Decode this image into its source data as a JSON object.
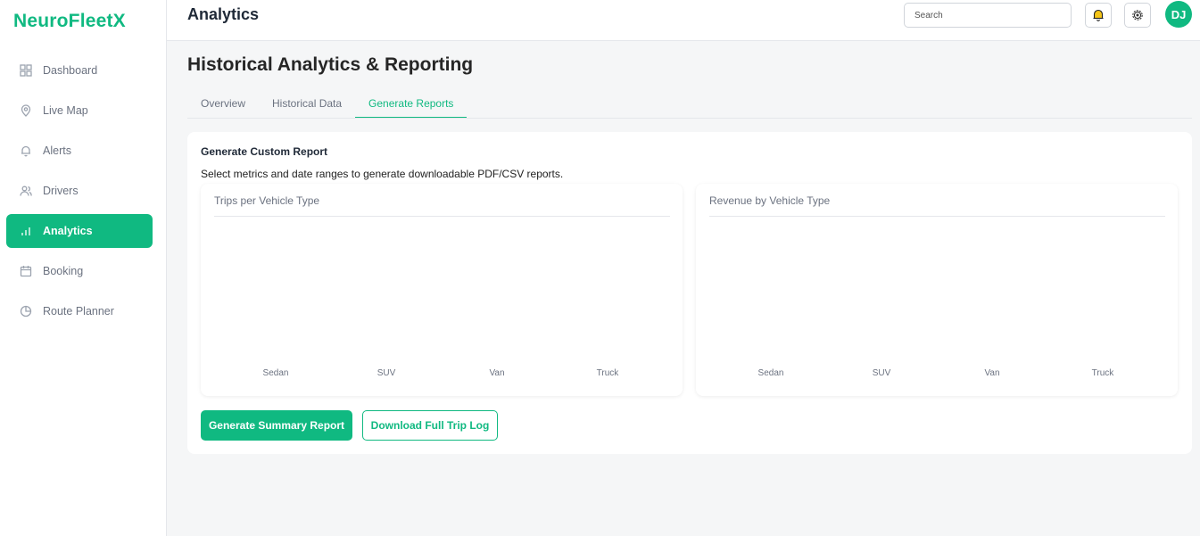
{
  "app": {
    "name": "NeuroFleetX"
  },
  "sidebar": {
    "items": [
      {
        "label": "Dashboard",
        "icon": "grid-icon"
      },
      {
        "label": "Live Map",
        "icon": "map-pin-icon"
      },
      {
        "label": "Alerts",
        "icon": "bell-icon"
      },
      {
        "label": "Drivers",
        "icon": "users-icon"
      },
      {
        "label": "Analytics",
        "icon": "bar-chart-icon",
        "active": true
      },
      {
        "label": "Booking",
        "icon": "calendar-icon"
      },
      {
        "label": "Route Planner",
        "icon": "pie-icon"
      }
    ]
  },
  "header": {
    "title": "Analytics",
    "search_placeholder": "Search",
    "avatar_initials": "DJ"
  },
  "page": {
    "title": "Historical Analytics & Reporting",
    "tabs": [
      {
        "label": "Overview"
      },
      {
        "label": "Historical Data"
      },
      {
        "label": "Generate Reports",
        "active": true
      }
    ]
  },
  "report": {
    "title": "Generate Custom Report",
    "subtitle": "Select metrics and date ranges to generate downloadable PDF/CSV reports.",
    "primary_button": "Generate Summary Report",
    "secondary_button": "Download Full Trip Log"
  },
  "colors": {
    "accent": "#10b981"
  },
  "chart_data": [
    {
      "type": "bar",
      "title": "Trips per Vehicle Type",
      "categories": [
        "Sedan",
        "SUV",
        "Van",
        "Truck"
      ],
      "values": [],
      "grid": false
    },
    {
      "type": "bar",
      "title": "Revenue by Vehicle Type",
      "categories": [
        "Sedan",
        "SUV",
        "Van",
        "Truck"
      ],
      "values": [],
      "grid": false
    }
  ]
}
